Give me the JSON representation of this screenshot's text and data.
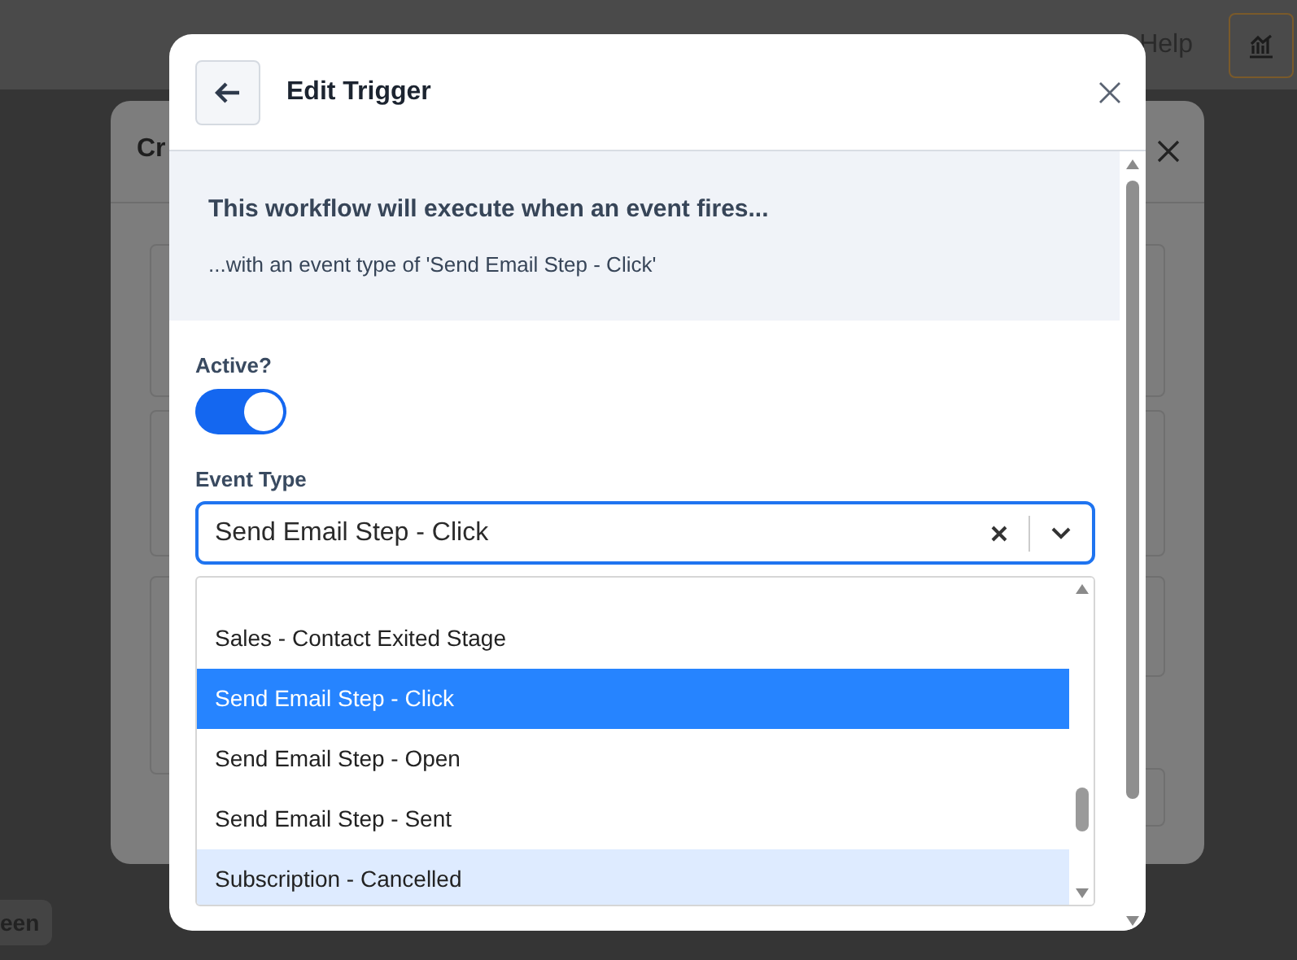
{
  "background": {
    "help": "Help",
    "dialog_title": "Cr",
    "chip": "een"
  },
  "header": {
    "title": "Edit Trigger"
  },
  "info": {
    "heading": "This workflow will execute when an event fires...",
    "detail": "...with an event type of 'Send Email Step - Click'"
  },
  "active": {
    "label": "Active?",
    "on": true
  },
  "event_type": {
    "label": "Event Type",
    "value": "Send Email Step - Click",
    "options": [
      {
        "label": "Sales - Contact Exited Stage",
        "selected": false,
        "focused": false
      },
      {
        "label": "Send Email Step - Click",
        "selected": true,
        "focused": false
      },
      {
        "label": "Send Email Step - Open",
        "selected": false,
        "focused": false
      },
      {
        "label": "Send Email Step - Sent",
        "selected": false,
        "focused": false
      },
      {
        "label": "Subscription - Cancelled",
        "selected": false,
        "focused": true
      }
    ]
  }
}
